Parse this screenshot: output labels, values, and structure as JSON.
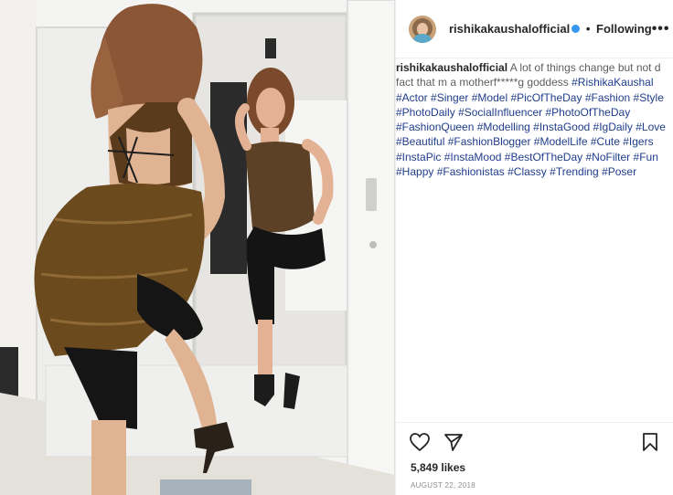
{
  "post": {
    "username": "rishikakaushalofficial",
    "follow_separator": "•",
    "follow_status": "Following",
    "more_icon": "more-options-icon",
    "more_label": "•••"
  },
  "caption": {
    "username": "rishikakaushalofficial",
    "text": "A lot of things change but not d fact that m a motherf*****g goddess",
    "hashtags": [
      "#RishikaKaushal",
      "#Actor",
      "#Singer",
      "#Model",
      "#PicOfTheDay",
      "#Fashion",
      "#Style",
      "#PhotoDaily",
      "#SocialInfluencer",
      "#PhotoOfTheDay",
      "#FashionQueen",
      "#Modelling",
      "#InstaGood",
      "#IgDaily",
      "#Love",
      "#Beautiful",
      "#FashionBlogger",
      "#ModelLife",
      "#Cute",
      "#Igers",
      "#InstaPic",
      "#InstaMood",
      "#BestOfTheDay",
      "#NoFilter",
      "#Fun",
      "#Happy",
      "#Fashionistas",
      "#Classy",
      "#Trending",
      "#Poser"
    ]
  },
  "actions": {
    "like_icon": "heart-icon",
    "share_icon": "send-icon",
    "save_icon": "bookmark-icon"
  },
  "stats": {
    "likes": "5,849 likes",
    "date": "AUGUST 22, 2018"
  },
  "colors": {
    "link": "#1f3d8c",
    "verified": "#3897f0",
    "dress": "#6b4a1e"
  }
}
